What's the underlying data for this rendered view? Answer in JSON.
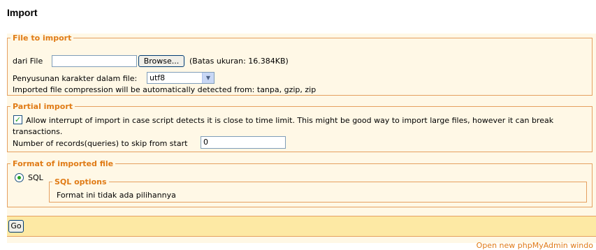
{
  "page_title": "Import",
  "file_section": {
    "legend": "File to import",
    "from_file_label": "dari File",
    "file_value": "",
    "browse_label": "Browse...",
    "size_limit": "(Batas ukuran: 16.384KB)",
    "charset_label": "Penyusunan karakter dalam file:",
    "charset_value": "utf8",
    "compression_note": "Imported file compression will be automatically detected from: tanpa, gzip, zip"
  },
  "partial_section": {
    "legend": "Partial import",
    "allow_interrupt_checked": true,
    "allow_interrupt_label_1": "Allow interrupt of import in case script detects it is close to time limit. This might be good way to import large files, however it can break",
    "allow_interrupt_label_2": "transactions.",
    "skip_label": "Number of records(queries) to skip from start",
    "skip_value": "0"
  },
  "format_section": {
    "legend": "Format of imported file",
    "format_option": "SQL",
    "format_selected": true,
    "sql_options_legend": "SQL options",
    "sql_options_text": "Format ini tidak ada pilihannya"
  },
  "go_label": "Go",
  "footer_link": "Open new phpMyAdmin windo"
}
